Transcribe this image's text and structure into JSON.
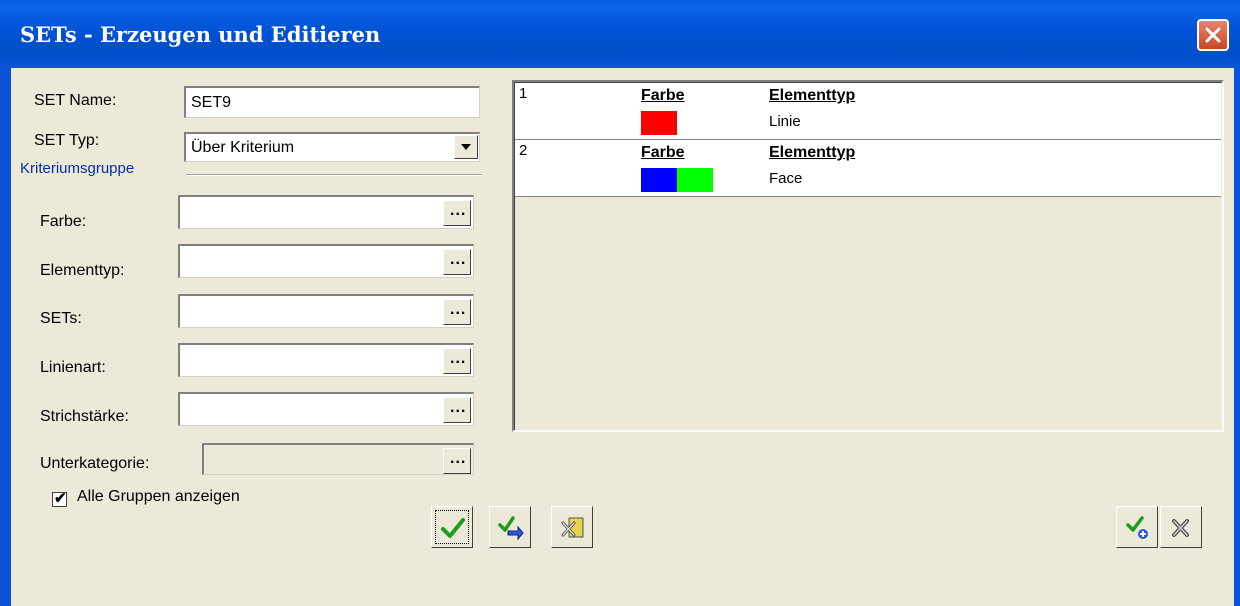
{
  "window": {
    "title": "SETs - Erzeugen und Editieren"
  },
  "form": {
    "set_name_label": "SET Name:",
    "set_name_value": "SET9",
    "set_type_label": "SET Typ:",
    "set_type_value": "Über Kriterium",
    "group_label": "Kriteriumsgruppe",
    "fields": [
      {
        "label": "Farbe:",
        "value": ""
      },
      {
        "label": "Elementtyp:",
        "value": ""
      },
      {
        "label": "SETs:",
        "value": ""
      },
      {
        "label": "Linienart:",
        "value": ""
      },
      {
        "label": "Strichstärke:",
        "value": ""
      },
      {
        "label": "Unterkategorie:",
        "value": ""
      }
    ],
    "browse_label": "...",
    "checkbox_label": "Alle Gruppen anzeigen",
    "checkbox_checked": true,
    "checkbox_mark": "✔"
  },
  "criteria_list": [
    {
      "index": "1",
      "col1_header": "Farbe",
      "colors": [
        "#ff0000"
      ],
      "col2_header": "Elementtyp",
      "col2_value": "Linie"
    },
    {
      "index": "2",
      "col1_header": "Farbe",
      "colors": [
        "#0000ff",
        "#00ff00"
      ],
      "col2_header": "Elementtyp",
      "col2_value": "Face"
    }
  ],
  "toolbar_icons": [
    "checkmark-icon",
    "check-with-arrow-icon",
    "edit-cancel-icon",
    "add-criteria-icon",
    "remove-criteria-icon"
  ]
}
